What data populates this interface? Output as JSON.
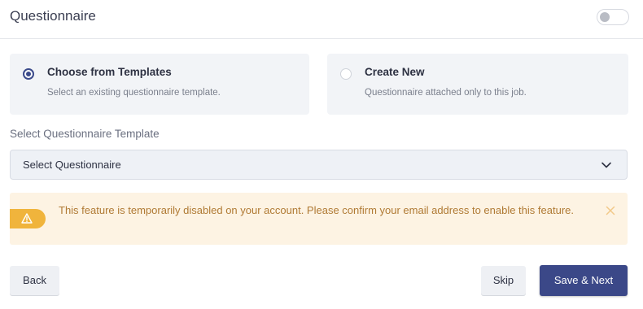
{
  "header": {
    "title": "Questionnaire",
    "toggle_on": false
  },
  "options": [
    {
      "title": "Choose from Templates",
      "description": "Select an existing questionnaire template.",
      "selected": true
    },
    {
      "title": "Create New",
      "description": "Questionnaire attached only to this job.",
      "selected": false
    }
  ],
  "template_select": {
    "label": "Select Questionnaire Template",
    "value": "Select Questionnaire"
  },
  "alert": {
    "message": "This feature is temporarily disabled on your account. Please confirm your email address to enable this feature.",
    "icon": "warning-icon"
  },
  "buttons": {
    "back": "Back",
    "skip": "Skip",
    "save_next": "Save & Next"
  },
  "colors": {
    "primary": "#3b4888",
    "alert_bg": "#fdf3e3",
    "alert_text": "#b07a34",
    "alert_accent": "#f0b43c"
  }
}
